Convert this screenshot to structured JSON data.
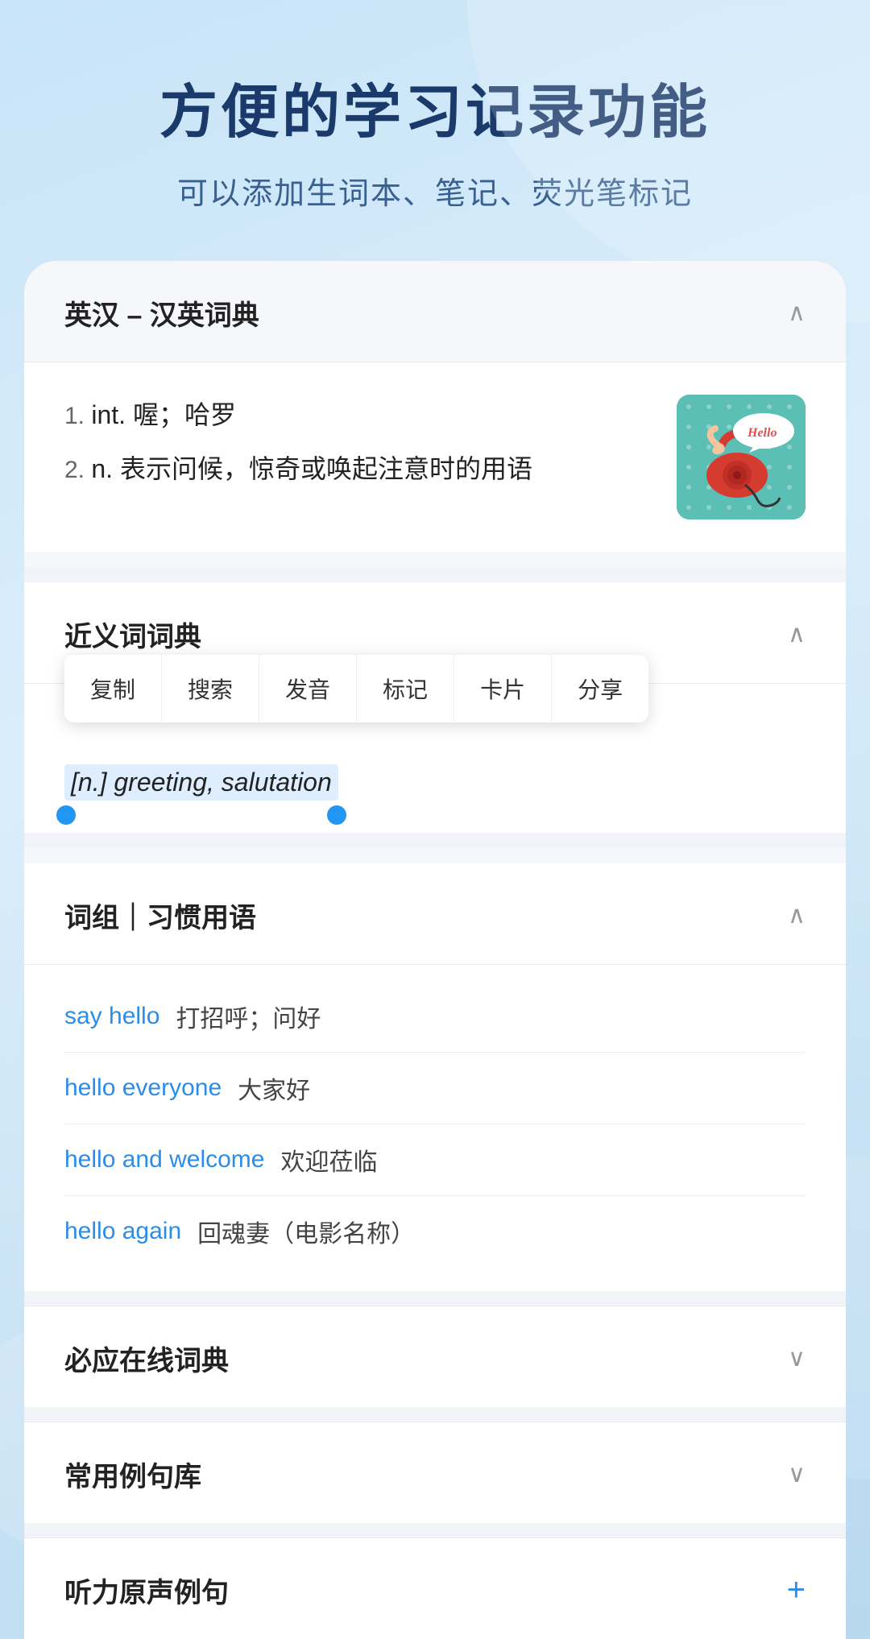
{
  "header": {
    "title": "方便的学习记录功能",
    "subtitle": "可以添加生词本、笔记、荧光笔标记"
  },
  "sections": {
    "en_zh_dict": {
      "title": "英汉 – 汉英词典",
      "collapsed": false,
      "definitions": [
        {
          "number": "1.",
          "type": "int.",
          "content": "喔；哈罗"
        },
        {
          "number": "2.",
          "type": "n.",
          "content": "表示问候，惊奇或唤起注意时的用语"
        }
      ]
    },
    "synonyms_dict": {
      "title": "近义词词典",
      "collapsed": false,
      "context_menu": {
        "items": [
          "复制",
          "搜索",
          "发音",
          "标记",
          "卡片",
          "分享"
        ]
      },
      "highlighted_text": "[n.] greeting, salutation"
    },
    "phrases": {
      "title": "词组｜习惯用语",
      "collapsed": false,
      "items": [
        {
          "english": "say hello",
          "chinese": "打招呼；问好"
        },
        {
          "english": "hello everyone",
          "chinese": "大家好"
        },
        {
          "english": "hello and welcome",
          "chinese": "欢迎莅临"
        },
        {
          "english": "hello again",
          "chinese": "回魂妻（电影名称）"
        }
      ]
    },
    "online_dict": {
      "title": "必应在线词典",
      "collapsed": true
    },
    "example_sentences": {
      "title": "常用例句库",
      "collapsed": true
    },
    "audio_examples": {
      "title": "听力原声例句",
      "has_plus": true
    }
  },
  "icons": {
    "chevron_up": "∧",
    "chevron_down": "∨",
    "plus": "+"
  },
  "colors": {
    "accent_blue": "#2b8de8",
    "title_dark": "#1a3a6b",
    "text_dark": "#222222",
    "text_gray": "#666666",
    "teal_bg": "#5bbfb5"
  }
}
